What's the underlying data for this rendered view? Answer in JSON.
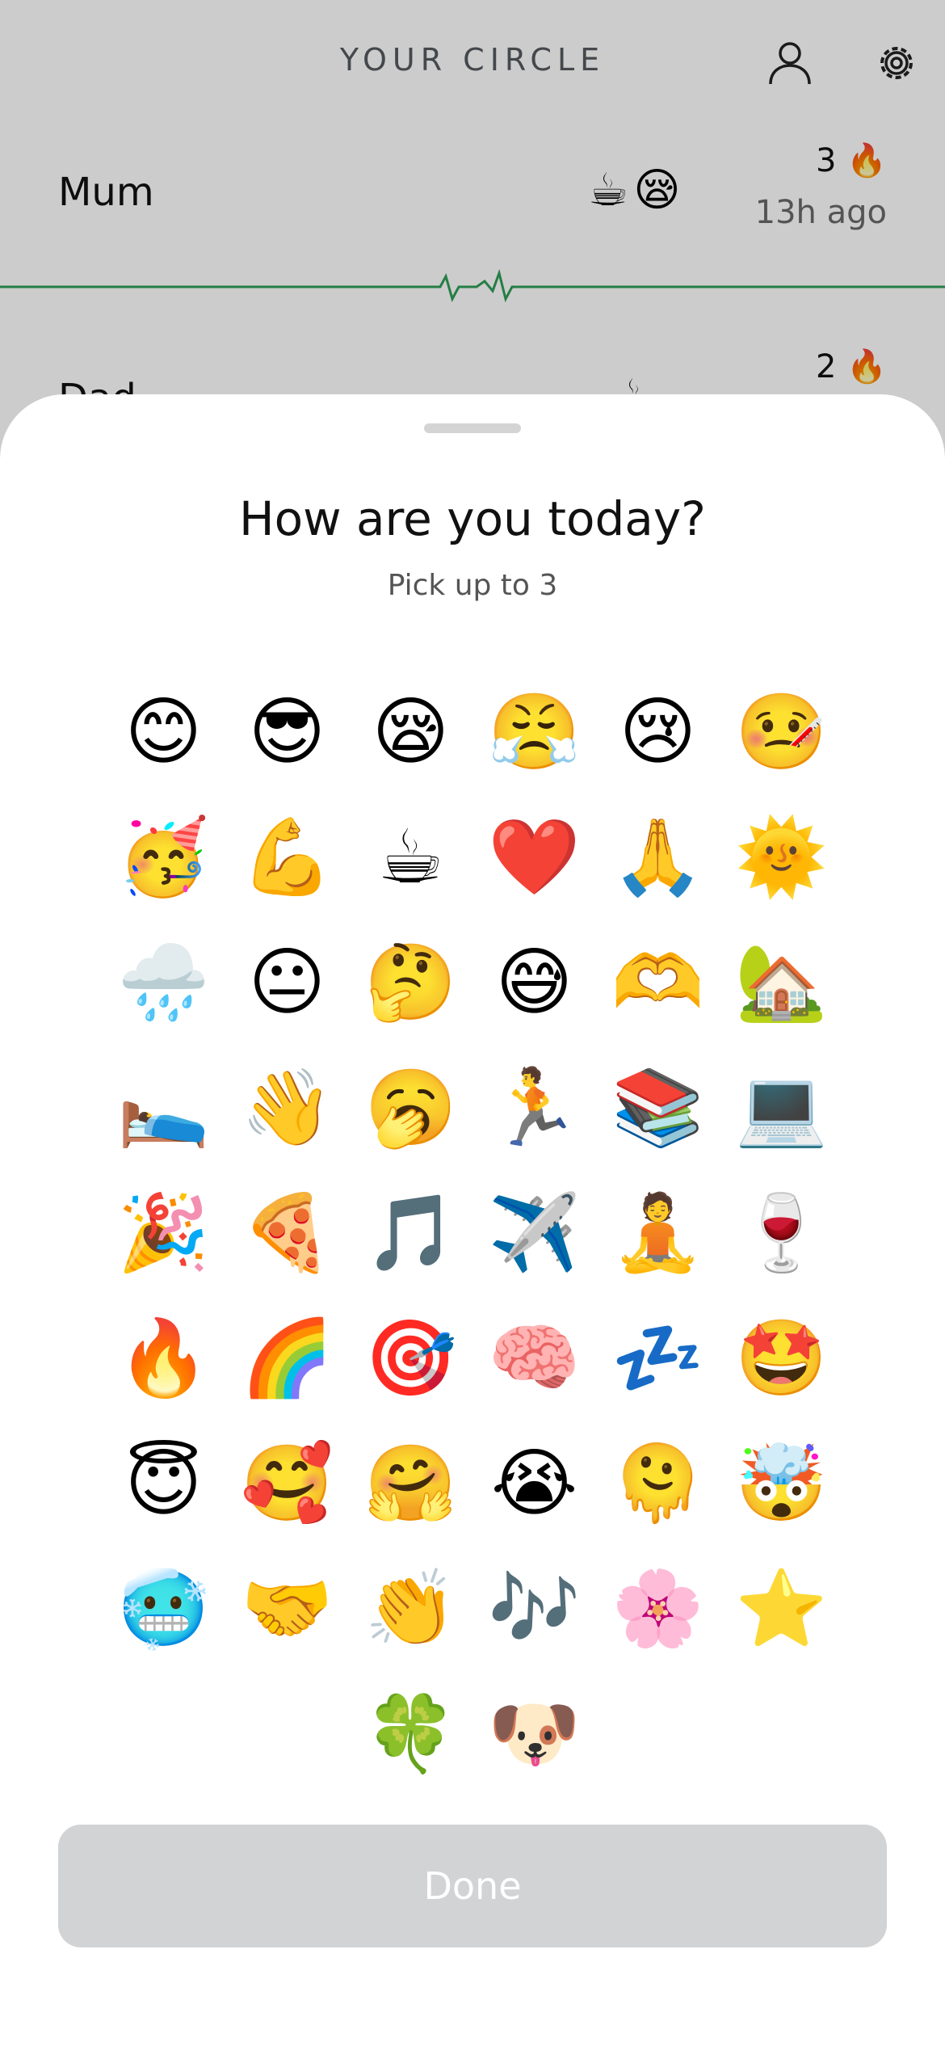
{
  "header": {
    "title": "YOUR CIRCLE",
    "profile_icon": "person-icon",
    "settings_icon": "gear-icon"
  },
  "circle": [
    {
      "name": "Mum",
      "moods": "☕😪",
      "streak": "3 🔥",
      "last_seen": "13h ago"
    },
    {
      "name": "Dad",
      "moods": "☕",
      "streak": "2 🔥",
      "last_seen": ""
    }
  ],
  "colors": {
    "pulse_line": "#2f9e55",
    "overlay": "rgba(0,0,0,0.2)",
    "done_disabled": "#d1d3d5"
  },
  "sheet": {
    "title": "How are you today?",
    "subtitle": "Pick up to 3",
    "emojis": [
      [
        "😊",
        "😎",
        "😪",
        "😤",
        "😢",
        "🤒"
      ],
      [
        "🥳",
        "💪",
        "☕",
        "❤️",
        "🙏",
        "🌞"
      ],
      [
        "🌧️",
        "😐",
        "🤔",
        "😅",
        "🫶",
        "🏡"
      ],
      [
        "🛌",
        "👋",
        "🥱",
        "🏃",
        "📚",
        "💻"
      ],
      [
        "🎉",
        "🍕",
        "🎵",
        "✈️",
        "🧘",
        "🍷"
      ],
      [
        "🔥",
        "🌈",
        "🎯",
        "🧠",
        "💤",
        "🤩"
      ],
      [
        "😇",
        "🥰",
        "🤗",
        "😭",
        "🫠",
        "🤯"
      ],
      [
        "🥶",
        "🤝",
        "👏",
        "🎶",
        "🌸",
        "⭐"
      ],
      [
        "🍀",
        "🐶"
      ]
    ],
    "done_label": "Done"
  }
}
